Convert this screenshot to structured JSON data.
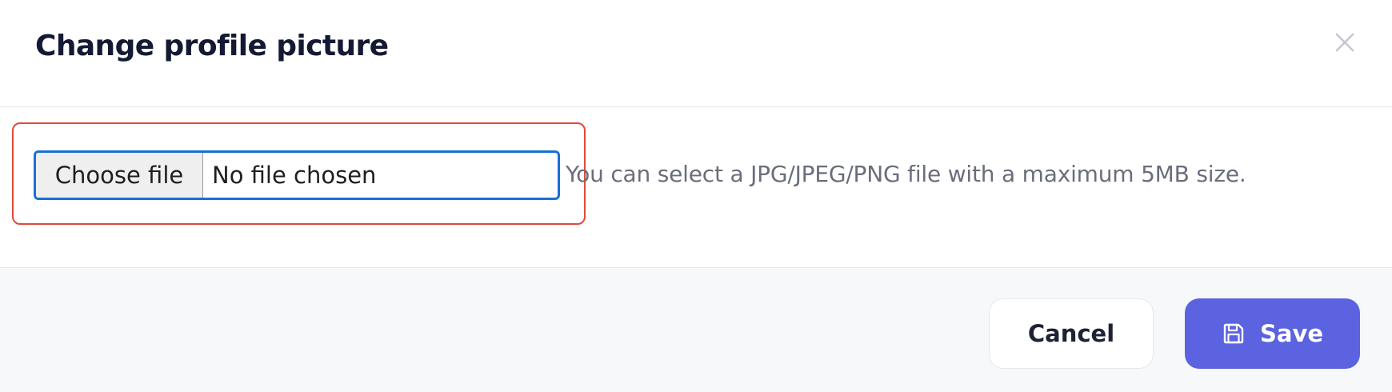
{
  "dialog": {
    "title": "Change profile picture",
    "close_icon": "close-icon"
  },
  "file_picker": {
    "button_label": "Choose file",
    "status": "No file chosen",
    "help_text": "You can select a JPG/JPEG/PNG file with a maximum 5MB size."
  },
  "footer": {
    "cancel_label": "Cancel",
    "save_label": "Save",
    "save_icon": "floppy-disk-icon"
  },
  "colors": {
    "accent": "#5c63e0",
    "highlight": "#e04a3b",
    "focus_ring": "#1a6fd6",
    "title": "#141a33"
  }
}
